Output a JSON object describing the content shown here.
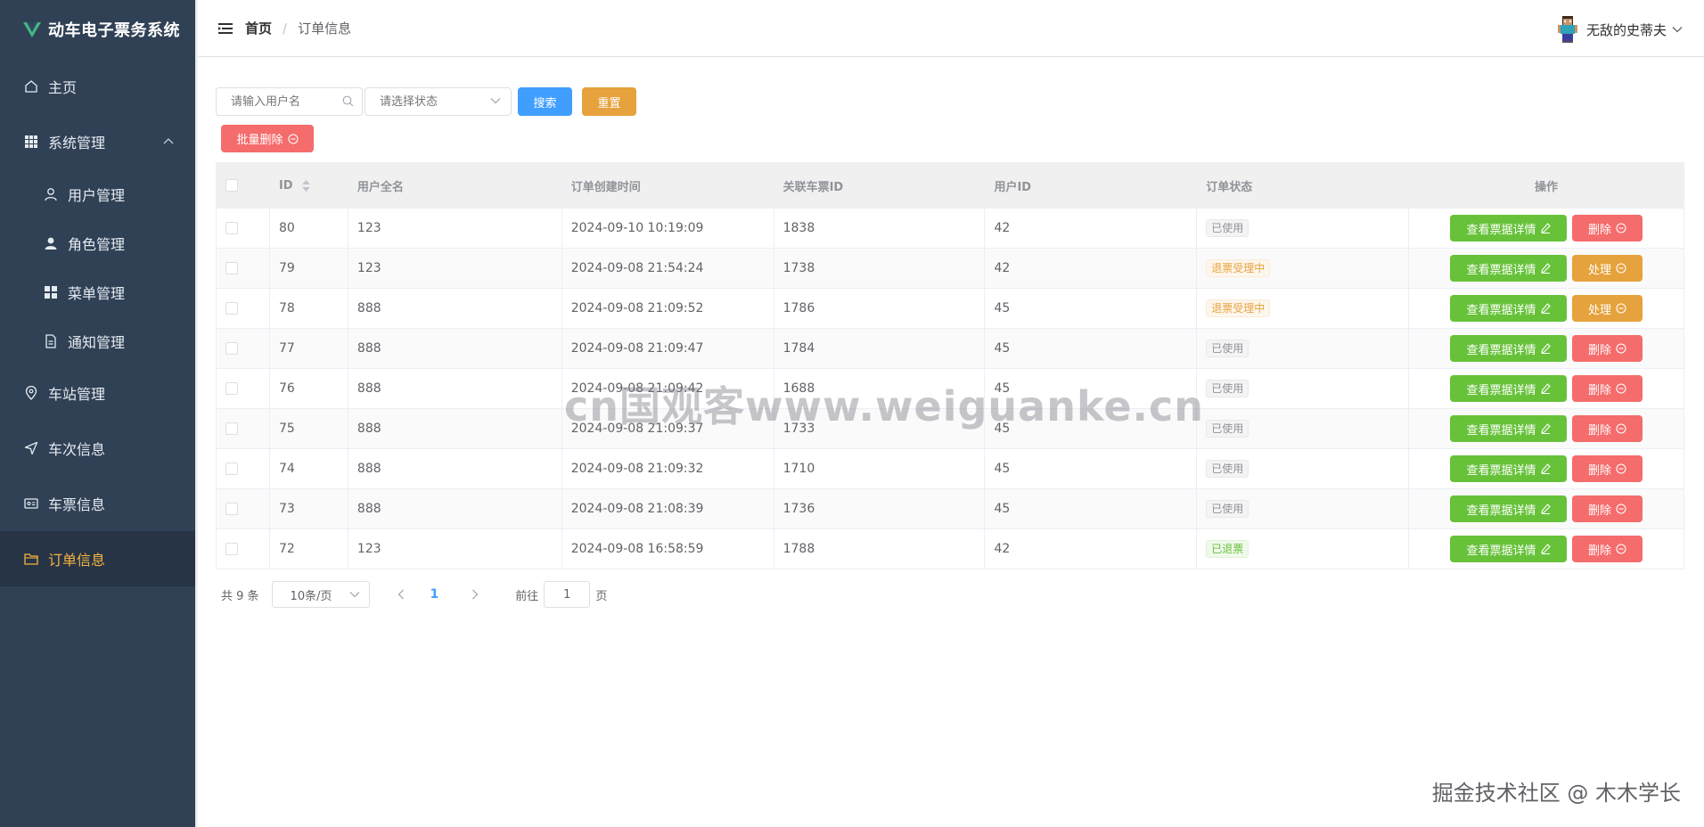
{
  "app": {
    "title": "动车电子票务系统"
  },
  "sidebar": {
    "items": [
      {
        "label": "主页",
        "icon": "home-icon"
      },
      {
        "label": "系统管理",
        "icon": "grid-icon",
        "expanded": true,
        "children": [
          {
            "label": "用户管理",
            "icon": "user-icon"
          },
          {
            "label": "角色管理",
            "icon": "person-filled-icon"
          },
          {
            "label": "菜单管理",
            "icon": "menu-grid-icon"
          },
          {
            "label": "通知管理",
            "icon": "document-icon"
          }
        ]
      },
      {
        "label": "车站管理",
        "icon": "location-icon"
      },
      {
        "label": "车次信息",
        "icon": "send-icon"
      },
      {
        "label": "车票信息",
        "icon": "ticket-icon"
      },
      {
        "label": "订单信息",
        "icon": "folder-icon",
        "active": true
      }
    ]
  },
  "header": {
    "breadcrumb": {
      "home": "首页",
      "separator": "/",
      "current": "订单信息"
    },
    "user": {
      "name": "无敌的史蒂夫"
    }
  },
  "filters": {
    "username_placeholder": "请输入用户名",
    "status_placeholder": "请选择状态",
    "search_label": "搜索",
    "reset_label": "重置",
    "batch_delete_label": "批量删除"
  },
  "table": {
    "headers": [
      "ID",
      "用户全名",
      "订单创建时间",
      "关联车票ID",
      "用户ID",
      "订单状态",
      "操作"
    ],
    "view_label": "查看票据详情",
    "rows": [
      {
        "id": "80",
        "fullname": "123",
        "created": "2024-09-10 10:19:09",
        "ticket_id": "1838",
        "user_id": "42",
        "status": "已使用",
        "status_type": "info",
        "action": "删除",
        "action_type": "danger"
      },
      {
        "id": "79",
        "fullname": "123",
        "created": "2024-09-08 21:54:24",
        "ticket_id": "1738",
        "user_id": "42",
        "status": "退票受理中",
        "status_type": "warning",
        "action": "处理",
        "action_type": "warning"
      },
      {
        "id": "78",
        "fullname": "888",
        "created": "2024-09-08 21:09:52",
        "ticket_id": "1786",
        "user_id": "45",
        "status": "退票受理中",
        "status_type": "warning",
        "action": "处理",
        "action_type": "warning"
      },
      {
        "id": "77",
        "fullname": "888",
        "created": "2024-09-08 21:09:47",
        "ticket_id": "1784",
        "user_id": "45",
        "status": "已使用",
        "status_type": "info",
        "action": "删除",
        "action_type": "danger"
      },
      {
        "id": "76",
        "fullname": "888",
        "created": "2024-09-08 21:09:42",
        "ticket_id": "1688",
        "user_id": "45",
        "status": "已使用",
        "status_type": "info",
        "action": "删除",
        "action_type": "danger"
      },
      {
        "id": "75",
        "fullname": "888",
        "created": "2024-09-08 21:09:37",
        "ticket_id": "1733",
        "user_id": "45",
        "status": "已使用",
        "status_type": "info",
        "action": "删除",
        "action_type": "danger"
      },
      {
        "id": "74",
        "fullname": "888",
        "created": "2024-09-08 21:09:32",
        "ticket_id": "1710",
        "user_id": "45",
        "status": "已使用",
        "status_type": "info",
        "action": "删除",
        "action_type": "danger"
      },
      {
        "id": "73",
        "fullname": "888",
        "created": "2024-09-08 21:08:39",
        "ticket_id": "1736",
        "user_id": "45",
        "status": "已使用",
        "status_type": "info",
        "action": "删除",
        "action_type": "danger"
      },
      {
        "id": "72",
        "fullname": "123",
        "created": "2024-09-08 16:58:59",
        "ticket_id": "1788",
        "user_id": "42",
        "status": "已退票",
        "status_type": "success",
        "action": "删除",
        "action_type": "danger"
      }
    ]
  },
  "pagination": {
    "total": "共 9 条",
    "page_size": "10条/页",
    "current_page": "1",
    "goto_prefix": "前往",
    "goto_value": "1",
    "goto_suffix": "页"
  },
  "watermarks": {
    "center": "cn国观客www.weiguanke.cn",
    "corner": "掘金技术社区 @ 木木学长"
  },
  "colors": {
    "sidebar_bg": "#304156",
    "active_menu": "#f5b342",
    "primary": "#409eff",
    "warning": "#e6a23c",
    "danger": "#f56c6c",
    "success": "#67c23a"
  }
}
